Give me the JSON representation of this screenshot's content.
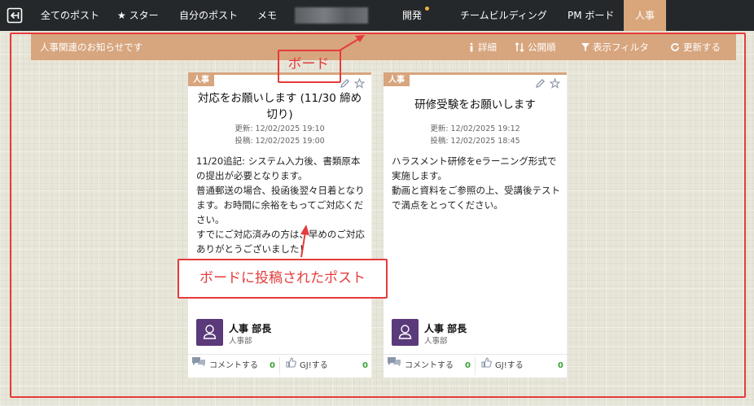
{
  "nav": {
    "items": [
      "全てのポスト",
      "スター",
      "自分のポスト",
      "メモ"
    ],
    "boards": [
      "開発",
      "チームビルディング",
      "PM ボード",
      "人事"
    ],
    "active": "人事"
  },
  "header": {
    "title": "人事関連のお知らせです",
    "actions": [
      "詳細",
      "公開順",
      "表示フィルタ",
      "更新する"
    ]
  },
  "annotations": {
    "board": "ボード",
    "post": "ボードに投稿されたポスト"
  },
  "cards": [
    {
      "tag": "人事",
      "title": "対応をお願いします (11/30 締め切り)",
      "updated": "更新: 12/02/2025 19:10",
      "posted": "投稿: 12/02/2025 19:00",
      "body": "11/20追記: システム入力後、書類原本の提出が必要となります。\n普通郵送の場合、投函後翌々日着となります。お時間に余裕をもってご対応ください。\nすでにご対応済みの方は、早めのご対応ありがとうございました！",
      "author": "人事 部長",
      "dept": "人事部",
      "comment_label": "コメントする",
      "comment_count": "0",
      "gj_label": "GJ!する",
      "gj_count": "0"
    },
    {
      "tag": "人事",
      "title": "研修受験をお願いします",
      "updated": "更新: 12/02/2025 19:12",
      "posted": "投稿: 12/02/2025 18:45",
      "body": "ハラスメント研修をeラーニング形式で実施します。\n動画と資料をご参照の上、受講後テストで満点をとってください。",
      "author": "人事 部長",
      "dept": "人事部",
      "comment_label": "コメントする",
      "comment_count": "0",
      "gj_label": "GJ!する",
      "gj_count": "0"
    }
  ],
  "colors": {
    "nav_bg": "#24282b",
    "accent": "#d7a57e",
    "annotation": "#e53b3b",
    "avatar": "#5a3a7a",
    "count": "#3aa33a"
  }
}
